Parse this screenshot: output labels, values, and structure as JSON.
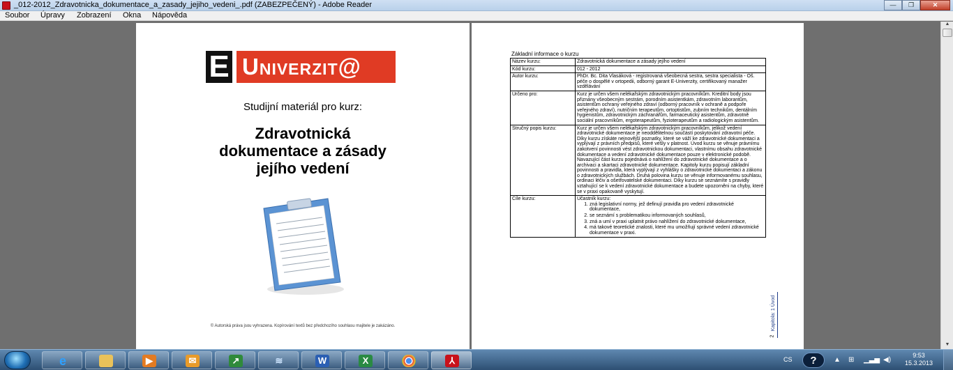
{
  "window": {
    "title": "_012-2012_Zdravotnicka_dokumentace_a_zasady_jejiho_vedeni_.pdf (ZABEZPEČENÝ) - Adobe Reader"
  },
  "menu": [
    "Soubor",
    "Úpravy",
    "Zobrazení",
    "Okna",
    "Nápověda"
  ],
  "left_page": {
    "logo_letter": "E",
    "logo_text": "Univerzit@",
    "subtitle": "Studijní materiál pro kurz:",
    "title_lines": [
      "Zdravotnická",
      "dokumentace a zásady",
      "jejího vedení"
    ],
    "footer": "© Autorská práva jsou vyhrazena. Kopírování textů bez předchozího souhlasu majitele je zakázáno."
  },
  "right_page": {
    "heading": "Základní informace o kurzu",
    "rows": [
      {
        "key": "Název kurzu:",
        "value": "Zdravotnická dokumentace a zásady jejího vedení"
      },
      {
        "key": "Kód kurzu:",
        "value": "012 - 2012"
      },
      {
        "key": "Autor kurzu:",
        "value": "PhDr. Bc. Dita Vlasáková - registrovaná všeobecná sestra, sestra specialista - Oš. péče o dospělé v ortopedii, odborný garant E-Univerzity, certifikovaný manažer vzdělávání"
      },
      {
        "key": "Určeno pro:",
        "value": "Kurz je určen všem nelékařským zdravotnickým pracovníkům. Kreditní body jsou přiznány všeobecným sestrám, porodním asistentkám, zdravotním laborantům, asistentům ochrany veřejného zdraví (odborný pracovník v ochraně a podpoře veřejného zdraví), nutričním terapeutům, ortoptistům, zubním technikům, dentálním hygienistům, zdravotnickým záchranářům, farmaceutický asistentům, zdravotně sociální pracovníkům, ergoterapeutům, fyzioterapeutům a radiologickým asistentům."
      },
      {
        "key": "Stručný popis kurzu:",
        "value": "Kurz je určen všem nelékařským zdravotnickým pracovníkům, jelikož vedení zdravotnické dokumentace je neoddělitelnou součástí poskytování zdravotní péče. Díky kurzu získáte nejnovější poznatky, které se váží ke zdravotnické dokumentaci a vyplývají z právních předpisů, které vešly v platnost. Úvod kurzu se věnuje právnímu zakotvení povinnosti vést zdravotnickou dokumentaci, vlastnímu obsahu zdravotnické dokumentace a vedení zdravotnické dokumentace pouze v elektronické podobě. Navazující část kurzu pojednává o nahlížení do zdravotnické dokumentace a o archivaci a skartaci zdravotnické dokumentace. Kapitoly kurzu popisují základní povinnosti a pravidla, která vyplývají z vyhlášky o zdravotnické dokumentaci a zákonu o zdravotnických službách. Druhá polovina kurzu se věnuje informovanému souhlasu, ordinaci léčiv a ošetřovatelské dokumentaci. Díky kurzu se seznámíte s pravidly vztahující se k vedení zdravotnické dokumentace a budete upozorněni na chyby, které se v praxi opakovaně vyskytují."
      }
    ],
    "objectives_key": "Cíle kurzu:",
    "objectives_intro": "Účastník kurzu:",
    "objectives": [
      "zná legislativní normy, jež definují pravidla pro vedení zdravotnické dokumentace,",
      "se seznámí s problematikou informovaných souhlasů,",
      "zná a umí v praxi uplatnit právo nahlížení do zdravotnické dokumentace,",
      "má takové teoretické znalosti, které mu umožňují správné vedení zdravotnické dokumentace v praxi."
    ],
    "page_number": "2",
    "side_label": "Kapitola: 1 Úvod"
  },
  "taskbar": {
    "language": "CS",
    "time": "9:53",
    "date": "15.3.2013",
    "apps": [
      "internet-explorer",
      "file-explorer",
      "media-player",
      "outlook",
      "stats-app",
      "wireless",
      "word",
      "excel",
      "chrome",
      "adobe-reader"
    ]
  },
  "colors": {
    "logo_red": "#e03b24",
    "taskbar": "#2d4f73",
    "doc_background": "#6f6f6f"
  }
}
